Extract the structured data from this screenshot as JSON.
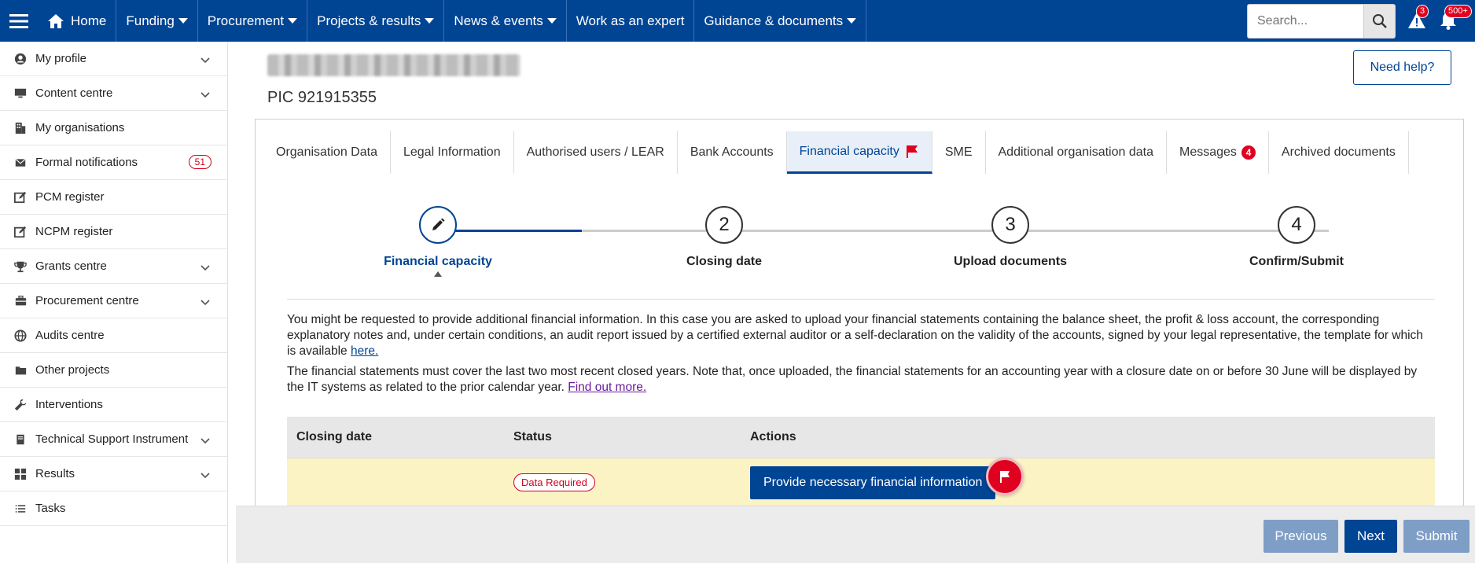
{
  "topbar": {
    "nav": [
      {
        "label": "Home",
        "icon": "home-icon",
        "caret": false
      },
      {
        "label": "Funding",
        "caret": true
      },
      {
        "label": "Procurement",
        "caret": true
      },
      {
        "label": "Projects & results",
        "caret": true
      },
      {
        "label": "News & events",
        "caret": true
      },
      {
        "label": "Work as an expert",
        "caret": false
      },
      {
        "label": "Guidance & documents",
        "caret": true
      }
    ],
    "search_placeholder": "Search...",
    "alerts_count": "3",
    "notifications_count": "500+"
  },
  "sidebar": {
    "items": [
      {
        "label": "My profile",
        "icon": "user-circle-icon",
        "expandable": true
      },
      {
        "label": "Content centre",
        "icon": "monitor-icon",
        "expandable": true
      },
      {
        "label": "My organisations",
        "icon": "building-icon",
        "expandable": false
      },
      {
        "label": "Formal notifications",
        "icon": "envelope-icon",
        "expandable": false,
        "count": "51"
      },
      {
        "label": "PCM register",
        "icon": "edit-square-icon",
        "expandable": false
      },
      {
        "label": "NCPM register",
        "icon": "edit-square-icon",
        "expandable": false
      },
      {
        "label": "Grants centre",
        "icon": "trophy-icon",
        "expandable": true
      },
      {
        "label": "Procurement centre",
        "icon": "briefcase-icon",
        "expandable": true
      },
      {
        "label": "Audits centre",
        "icon": "globe-icon",
        "expandable": false
      },
      {
        "label": "Other projects",
        "icon": "folder-icon",
        "expandable": false
      },
      {
        "label": "Interventions",
        "icon": "wrench-icon",
        "expandable": false
      },
      {
        "label": "Technical Support Instrument",
        "icon": "book-icon",
        "expandable": true
      },
      {
        "label": "Results",
        "icon": "grid-icon",
        "expandable": true
      },
      {
        "label": "Tasks",
        "icon": "list-icon",
        "expandable": false
      }
    ]
  },
  "page": {
    "pic": "PIC 921915355",
    "help_label": "Need help?"
  },
  "tabs": [
    {
      "label": "Organisation Data"
    },
    {
      "label": "Legal Information"
    },
    {
      "label": "Authorised users / LEAR"
    },
    {
      "label": "Bank Accounts"
    },
    {
      "label": "Financial capacity",
      "active": true,
      "flag": true
    },
    {
      "label": "SME"
    },
    {
      "label": "Additional organisation data"
    },
    {
      "label": "Messages",
      "count": "4"
    },
    {
      "label": "Archived documents"
    }
  ],
  "stepper": {
    "steps": [
      {
        "number": "",
        "label": "Financial capacity",
        "active": true
      },
      {
        "number": "2",
        "label": "Closing date"
      },
      {
        "number": "3",
        "label": "Upload documents"
      },
      {
        "number": "4",
        "label": "Confirm/Submit"
      }
    ]
  },
  "content": {
    "p1_text": "You might be requested to provide additional financial information. In this case you are asked to upload your financial statements containing the balance sheet, the profit & loss account, the corresponding explanatory notes and, under certain conditions, an audit report issued by a certified external auditor or a self-declaration on the validity of the accounts, signed by your legal representative, the template for which is available ",
    "p1_link": "here.",
    "p2_text": "The financial statements must cover the last two most recent closed years. Note that, once uploaded, the financial statements for an accounting year with a closure date on or before 30 June will be displayed by the IT systems as related to the prior calendar year. ",
    "p2_link": "Find out more."
  },
  "table": {
    "headers": [
      "Closing date",
      "Status",
      "Actions"
    ],
    "row": {
      "closing_date": "",
      "status": "Data Required",
      "action_label": "Provide necessary financial information"
    }
  },
  "footer": {
    "previous": "Previous",
    "next": "Next",
    "submit": "Submit"
  },
  "colors": {
    "brand": "#004494",
    "alert": "#e0001f",
    "row_highlight": "#fcf3c4"
  }
}
